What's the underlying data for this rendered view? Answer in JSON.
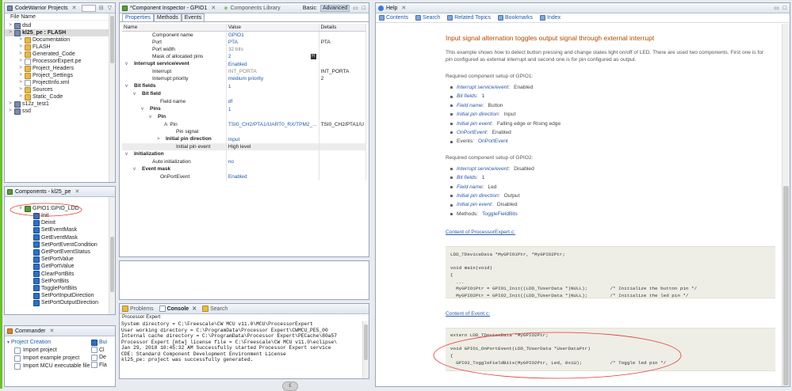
{
  "projects": {
    "title": "CodeWarrior Projects",
    "file_name_label": "File Name",
    "items": [
      {
        "label": "dsd",
        "indent": 0,
        "icon": "proj"
      },
      {
        "label": "kl25_pe : FLASH",
        "indent": 0,
        "icon": "proj",
        "bold": true
      },
      {
        "label": "Documentation",
        "indent": 1,
        "icon": "folder"
      },
      {
        "label": "FLASH",
        "indent": 1,
        "icon": "folder"
      },
      {
        "label": "Generated_Code",
        "indent": 1,
        "icon": "folder"
      },
      {
        "label": "ProcessorExpert.pe",
        "indent": 1,
        "icon": "file"
      },
      {
        "label": "Project_Headers",
        "indent": 1,
        "icon": "folder"
      },
      {
        "label": "Project_Settings",
        "indent": 1,
        "icon": "folder"
      },
      {
        "label": "ProjectInfo.xml",
        "indent": 1,
        "icon": "file"
      },
      {
        "label": "Sources",
        "indent": 1,
        "icon": "folder"
      },
      {
        "label": "Static_Code",
        "indent": 1,
        "icon": "folder"
      },
      {
        "label": "s12z_test1",
        "indent": 0,
        "icon": "proj"
      },
      {
        "label": "ssd",
        "indent": 0,
        "icon": "proj"
      }
    ]
  },
  "components": {
    "title": "Components - kl25_pe",
    "root": "GPIO1:GPIO_LDD",
    "methods": [
      "Init",
      "Deinit",
      "SetEventMask",
      "GetEventMask",
      "SetPortEventCondition",
      "GetPortEventStatus",
      "SetPortValue",
      "GetPortValue",
      "ClearPortBits",
      "SetPortBits",
      "TogglePortBits",
      "SetPortInputDirection",
      "SetPortOutputDirection"
    ]
  },
  "commander": {
    "title": "Commander",
    "section": "Project Creation",
    "items": [
      "Import project",
      "Import example project",
      "Import MCU executable file"
    ],
    "side_items": [
      "Bui",
      "Cl",
      "De",
      "Fla"
    ]
  },
  "inspector": {
    "title": "*Component Inspector - GPIO1",
    "other_tab": "Components Library",
    "mode_basic": "Basic",
    "mode_advanced": "Advanced",
    "subtabs": [
      "Properties",
      "Methods",
      "Events"
    ],
    "columns": [
      "Name",
      "Value",
      "Details"
    ],
    "rows": [
      {
        "indent": 1,
        "name": "Component name",
        "value": "GPIO1",
        "details": ""
      },
      {
        "indent": 1,
        "name": "Port",
        "value": "PTA",
        "details": "PTA"
      },
      {
        "indent": 1,
        "name": "Port width",
        "value": "32 bits",
        "details": "",
        "gray": true
      },
      {
        "indent": 1,
        "name": "Mask of allocated pins",
        "value": "2",
        "details": ""
      },
      {
        "indent": 0,
        "name": "Interrupt service/event",
        "value": "Enabled",
        "details": "",
        "bold": true,
        "tw": "v"
      },
      {
        "indent": 1,
        "name": "Interrupt",
        "value": "INT_PORTA",
        "details": "INT_PORTA",
        "gray": true
      },
      {
        "indent": 1,
        "name": "Interrupt priority",
        "value": "medium priority",
        "details": "2"
      },
      {
        "indent": 0,
        "name": "Bit fields",
        "value": "1",
        "details": "",
        "bold": true,
        "tw": "v"
      },
      {
        "indent": 1,
        "name": "Bit field",
        "value": "",
        "details": "",
        "bold": true,
        "tw": "v"
      },
      {
        "indent": 2,
        "name": "Field name",
        "value": "df",
        "details": ""
      },
      {
        "indent": 2,
        "name": "Pins",
        "value": "1",
        "details": "",
        "bold": true,
        "tw": "v"
      },
      {
        "indent": 3,
        "name": "Pin",
        "value": "",
        "details": "",
        "bold": true,
        "tw": "v"
      },
      {
        "indent": 4,
        "name": "Pin",
        "value": "TSI0_CH2/PTA1/UART0_RX/TPM2_...",
        "details": "TSI0_CH2/PTA1/U",
        "pinicon": true
      },
      {
        "indent": 4,
        "name": "Pin signal",
        "value": "",
        "details": ""
      },
      {
        "indent": 4,
        "name": "Initial pin direction",
        "value": "Input",
        "details": "",
        "bold": true,
        "tw": ">"
      },
      {
        "indent": 4,
        "name": "Initial pin event",
        "value": "High level",
        "details": "",
        "selected": true
      },
      {
        "indent": 0,
        "name": "Initialization",
        "value": "",
        "details": "",
        "bold": true,
        "tw": "v"
      },
      {
        "indent": 1,
        "name": "Auto initialization",
        "value": "no",
        "details": ""
      },
      {
        "indent": 1,
        "name": "Event mask",
        "value": "",
        "details": "",
        "bold": true,
        "tw": "v"
      },
      {
        "indent": 2,
        "name": "OnPortEvent",
        "value": "Enabled",
        "details": ""
      }
    ]
  },
  "console": {
    "tabs": [
      "Problems",
      "Console",
      "Search"
    ],
    "header": "Processor Expert",
    "lines": [
      "System directory = C:\\Freescale\\CW MCU v11.0\\MCU\\ProcessorExpert",
      "User working directory = C:\\ProgramData\\Processor Expert\\CWMCU_PE5_00",
      "Internal cache directory = C:\\ProgramData\\Processor Expert\\PECache\\80a57",
      "Processor Expert [mtw] license file = C:\\Freescale\\CW MCU v11.0\\eclipse\\",
      "Jan 29, 2018 10:45:32 AM Successfully started Processor Expert service",
      "CDE: Standard Component Development Environment License",
      "kl25_pe: project was successfully generated."
    ]
  },
  "help": {
    "title": "Help",
    "toolbar": [
      "Contents",
      "Search",
      "Related Topics",
      "Bookmarks",
      "Index"
    ],
    "heading": "Input signal alternation toggles output signal through external interrupt",
    "intro": "This example shows how to detect button pressing and change states light on/off of LED. There are used two components. First one is for pin configured as external interrupt and second one is for pin configured as output.",
    "setup1_label": "Required component setup of GPIO1:",
    "setup1": [
      {
        "k": "Interrupt service/event",
        "v": "Enabled"
      },
      {
        "k": "Bit fields",
        "v": "1"
      },
      {
        "k": "Field name",
        "v": "Button"
      },
      {
        "k": "Initial pin direction",
        "v": "Input"
      },
      {
        "k": "Initial pin event",
        "v": "Falling edge or Rising edge"
      },
      {
        "k": "OnPortEvent",
        "v": "Enabled"
      },
      {
        "k": "Events",
        "v": "OnPortEvent",
        "plain": true
      }
    ],
    "setup2_label": "Required component setup of GPIO2:",
    "setup2": [
      {
        "k": "Interrupt service/event",
        "v": "Disabled"
      },
      {
        "k": "Bit fields",
        "v": "1"
      },
      {
        "k": "Field name",
        "v": "Led"
      },
      {
        "k": "Initial pin direction",
        "v": "Output"
      },
      {
        "k": "Initial pin event",
        "v": "Disabled"
      },
      {
        "k": "Methods",
        "v": "ToggleFieldBits",
        "plain": true
      }
    ],
    "content1_link": "Content of ProcessorExpert.c:",
    "code1": "LDD_TDeviceData *MyGPIO1Ptr, *MyGPIO2Ptr;\n\nvoid main(void)\n{\n  ...\n  MyGPIO1Ptr = GPIO1_Init((LDD_TUserData *)NULL);        /* Initialize the button pin */\n  MyGPIO2Ptr = GPIO2_Init((LDD_TUserData *)NULL);        /* Initialize the led pin */",
    "content2_link": "Content of Event.c:",
    "code2": "extern LDD_TDeviceData *MyGPIO2Ptr;\n\nvoid GPIO1_OnPortEvent(LDD_TUserData *UserDataPtr)\n{\n  GPIO2_ToggleFieldBits(MyGPIO2Ptr, Led, 0x1U);          /* Toggle led pin */"
  },
  "colors": {
    "annotation": "#e53935",
    "accent": "#2b58a8",
    "heading": "#b04a00"
  }
}
